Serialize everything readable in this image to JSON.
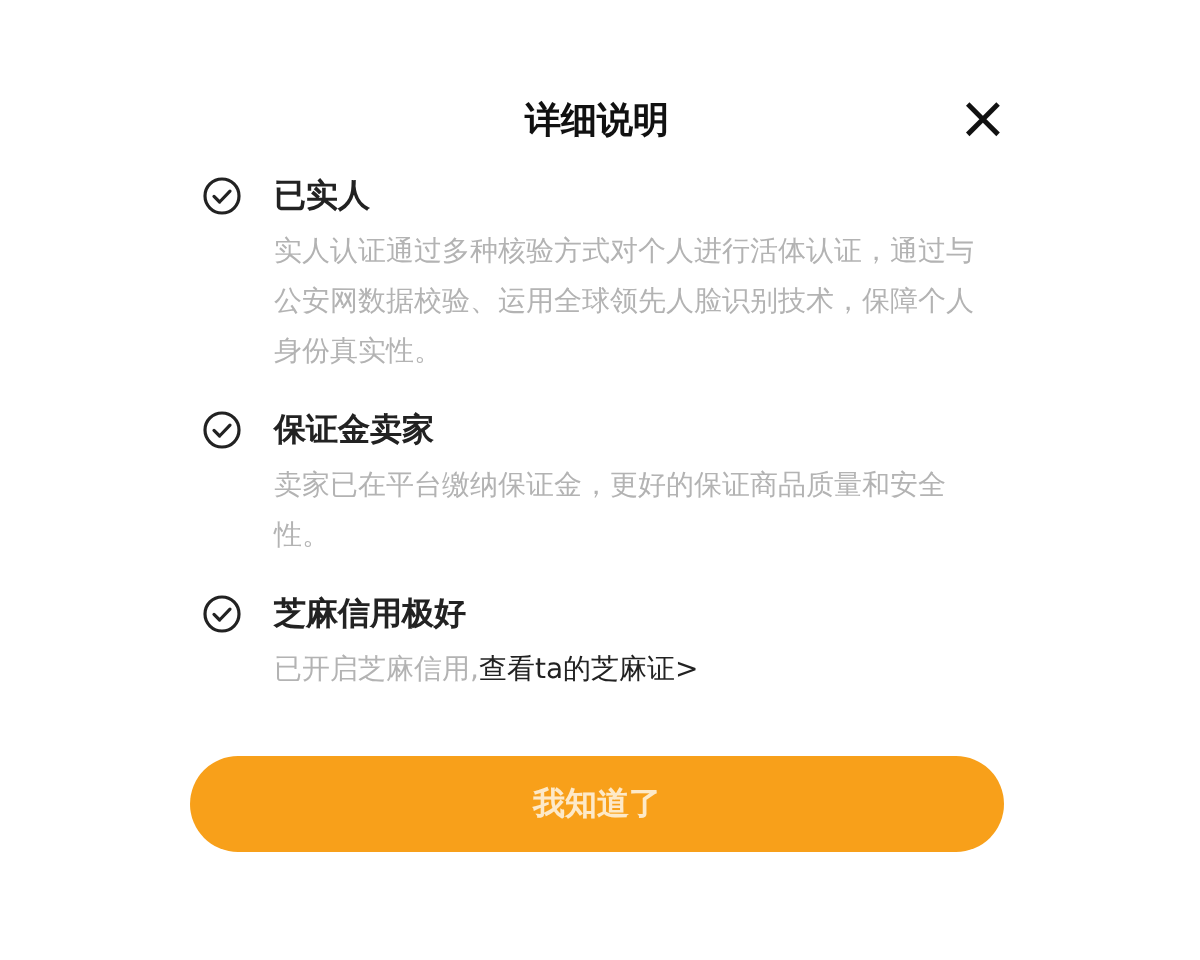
{
  "dialog": {
    "title": "详细说明",
    "close": "×"
  },
  "items": [
    {
      "title": "已实人",
      "checked": true,
      "description": "实人认证通过多种核验方式对个人进行活体认证，通过与公安网数据校验、运用全球领先人脸识别技术，保障个人身份真实性。"
    },
    {
      "title": "保证金卖家",
      "checked": true,
      "description": "卖家已在平台缴纳保证金，更好的保证商品质量和安全性。"
    },
    {
      "title": "芝麻信用极好",
      "checked": true,
      "description": "已开启芝麻信用,",
      "link": "查看ta的芝麻证>"
    }
  ],
  "button": "我知道了"
}
